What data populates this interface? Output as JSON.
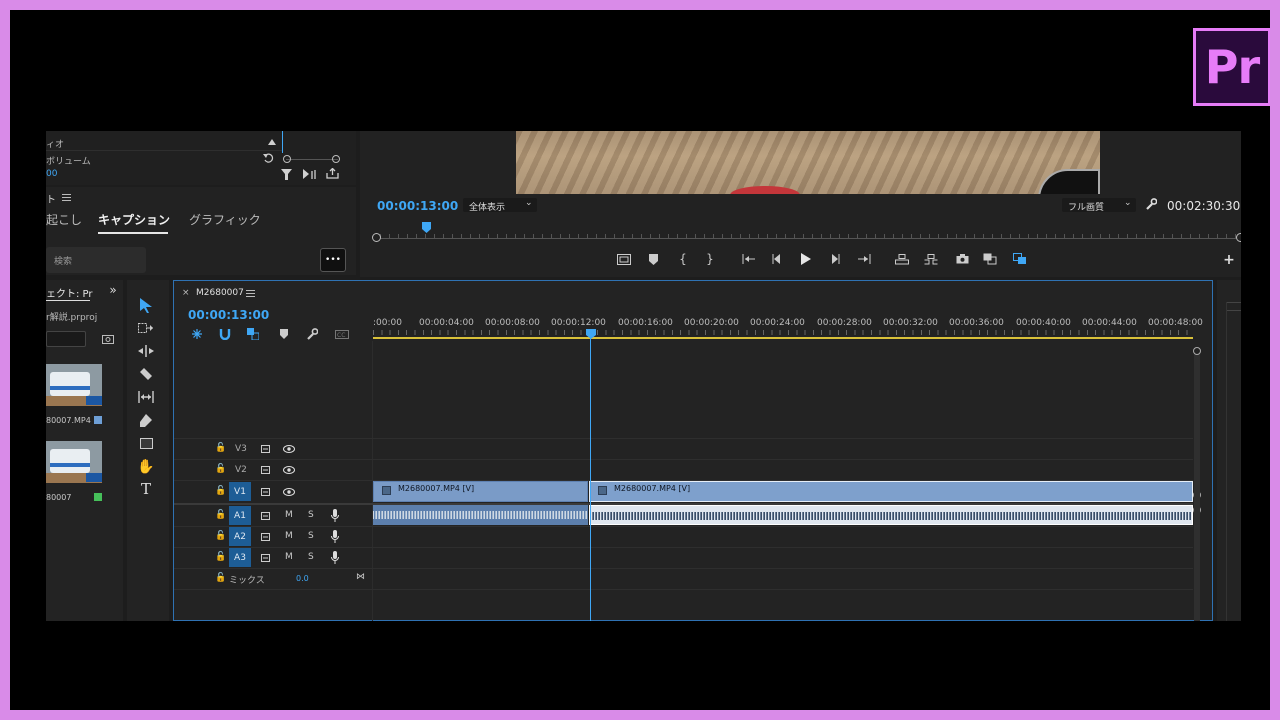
{
  "app": {
    "logo_text": "Pr",
    "brand_color": "#e77cf8",
    "accent": "#3fa7f5"
  },
  "audio_panel": {
    "row1_label": "ィオ",
    "row2_label": "ボリューム",
    "value": "00"
  },
  "text_panel": {
    "header": "ト",
    "tabs": [
      "起こし",
      "キャプション",
      "グラフィック"
    ],
    "active_tab": "キャプション",
    "search_placeholder": "検索",
    "more_label": "•••"
  },
  "project_panel": {
    "tab_label": "ェクト: Pr",
    "project_file": "r解説.prproj",
    "clips": [
      {
        "name": "80007.MP4",
        "color": "#6e9fd6"
      },
      {
        "name": "80007",
        "color": "#46c05a"
      }
    ]
  },
  "program_monitor": {
    "timecode": "00:00:13:00",
    "zoom_select": "全体表示",
    "quality_select": "フル画質",
    "duration": "00:02:30:30",
    "playhead_fraction": 0.054
  },
  "timeline": {
    "sequence_name": "M2680007",
    "timecode": "00:00:13:00",
    "ruler_labels": [
      ":00:00",
      "00:00:04:00",
      "00:00:08:00",
      "00:00:12:00",
      "00:00:16:00",
      "00:00:20:00",
      "00:00:24:00",
      "00:00:28:00",
      "00:00:32:00",
      "00:00:36:00",
      "00:00:40:00",
      "00:00:44:00",
      "00:00:48:00"
    ],
    "video_tracks": [
      "V3",
      "V2",
      "V1"
    ],
    "audio_tracks": [
      "A1",
      "A2",
      "A3"
    ],
    "mute_label": "M",
    "solo_label": "S",
    "mix_label": "ミックス",
    "mix_value": "0.0",
    "clips": [
      {
        "label": "M2680007.MP4 [V]"
      },
      {
        "label": "M2680007.MP4 [V]"
      }
    ]
  }
}
